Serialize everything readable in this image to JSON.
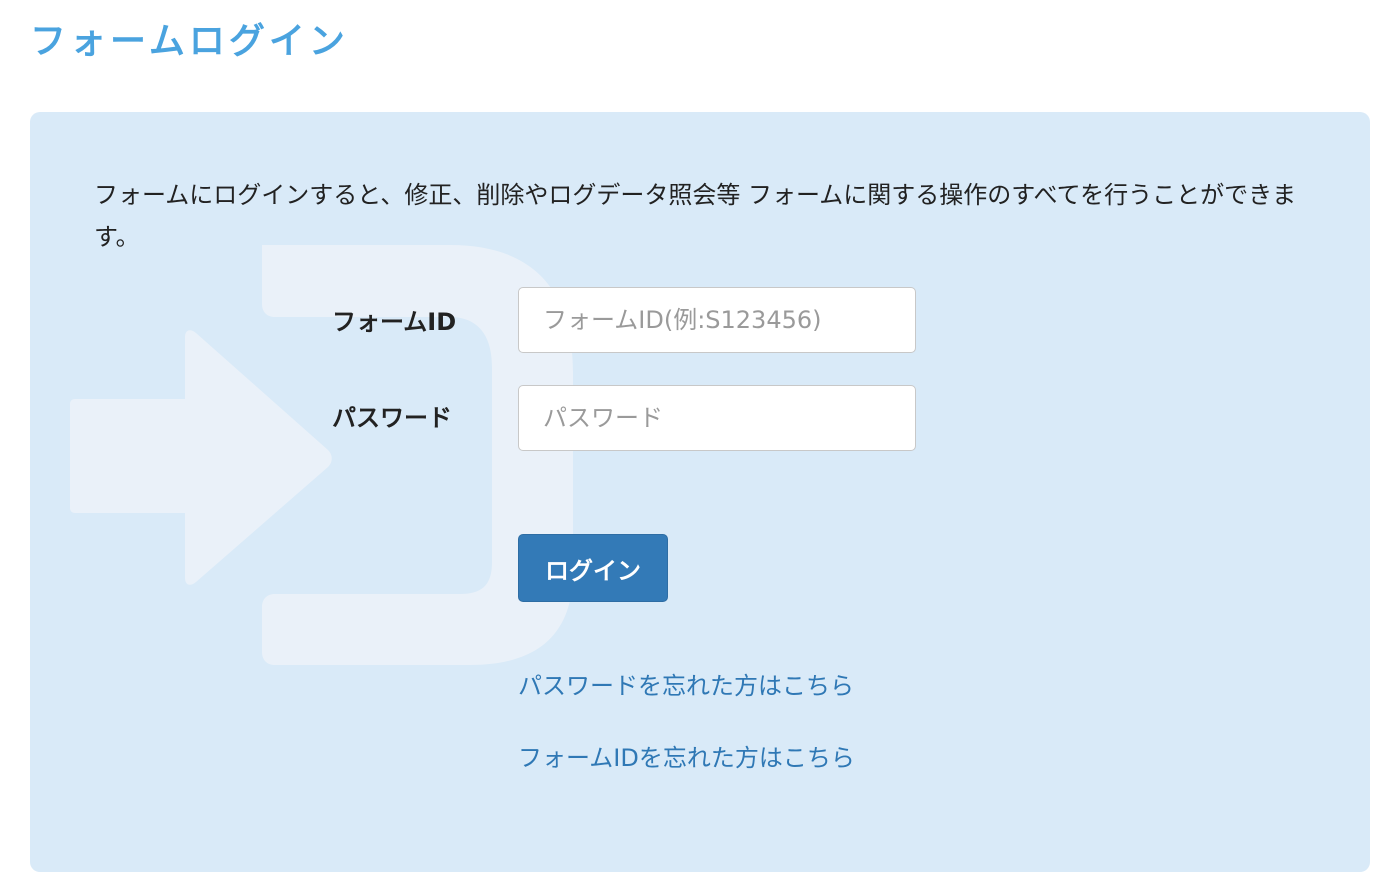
{
  "page": {
    "title": "フォームログイン"
  },
  "panel": {
    "description": "フォームにログインすると、修正、削除やログデータ照会等 フォームに関する操作のすべてを行うことができます。",
    "form_id": {
      "label": "フォームID",
      "placeholder": "フォームID(例:S123456)",
      "value": ""
    },
    "password": {
      "label": "パスワード",
      "placeholder": "パスワード",
      "value": ""
    },
    "login_button_label": "ログイン",
    "links": {
      "forgot_password": "パスワードを忘れた方はこちら",
      "forgot_form_id": "フォームIDを忘れた方はこちら"
    },
    "watermark_icon": "login-arrow-icon"
  },
  "colors": {
    "title": "#4aa3df",
    "panel_background": "#d9eaf8",
    "button_background": "#337ab7",
    "link": "#2f78b5"
  }
}
